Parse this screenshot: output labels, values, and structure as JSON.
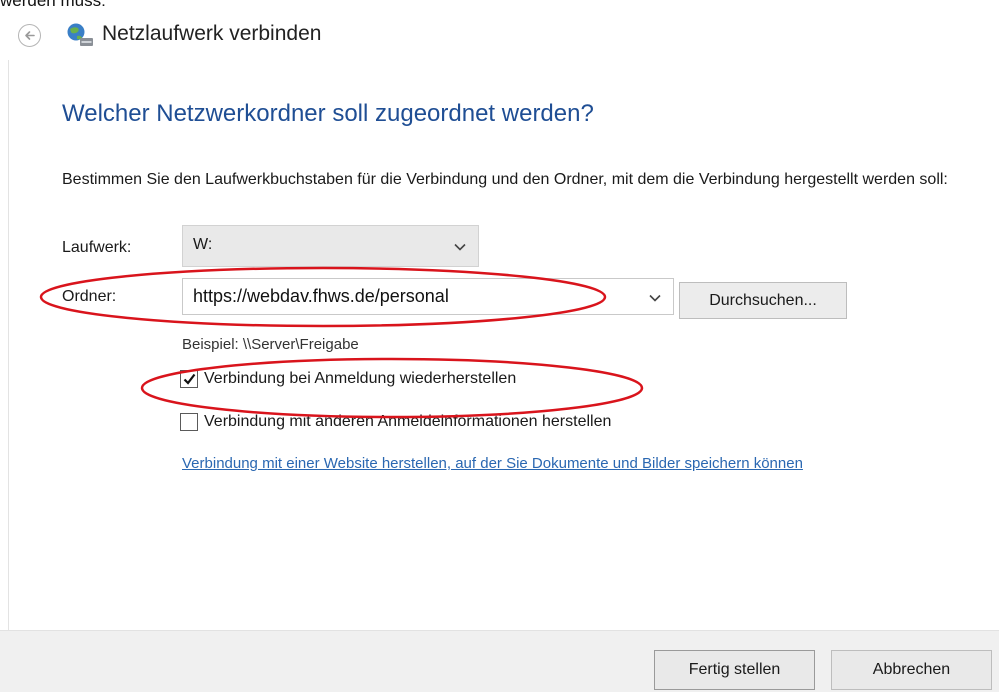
{
  "page_header_fragment": "werden muss:",
  "window": {
    "title": "Netzlaufwerk verbinden",
    "back_icon": "back-arrow-icon",
    "app_icon": "network-drive-icon"
  },
  "content": {
    "heading": "Welcher Netzwerkordner soll zugeordnet werden?",
    "description": "Bestimmen Sie den Laufwerkbuchstaben für die Verbindung und den Ordner, mit dem die Verbindung hergestellt werden soll:"
  },
  "form": {
    "drive_label": "Laufwerk:",
    "drive_value": "W:",
    "folder_label": "Ordner:",
    "folder_value": "https://webdav.fhws.de/personal",
    "browse_button": "Durchsuchen...",
    "example_text": "Beispiel: \\\\Server\\Freigabe",
    "reconnect_label": "Verbindung bei Anmeldung wiederherstellen",
    "reconnect_checked": true,
    "other_credentials_label": "Verbindung mit anderen Anmeldeinformationen herstellen",
    "other_credentials_checked": false,
    "website_link": "Verbindung mit einer Website herstellen, auf der Sie Dokumente und Bilder speichern können"
  },
  "footer": {
    "finish_button": "Fertig stellen",
    "cancel_button": "Abbrechen"
  },
  "colors": {
    "heading": "#1f4e94",
    "link": "#2a67b1",
    "annotation_ellipse": "#d9141c"
  }
}
